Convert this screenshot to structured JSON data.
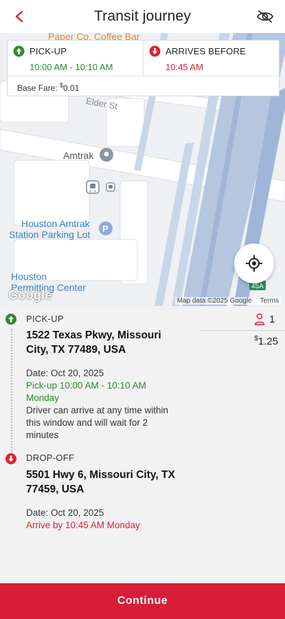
{
  "header": {
    "title": "Transit journey",
    "back_icon": "chevron-left-icon",
    "visibility_icon": "eye-off-icon"
  },
  "map": {
    "labels": {
      "coffee": "Paper Co. Coffee Bar",
      "street": "Elder St",
      "amtrak": "Amtrak",
      "parking_line1": "Houston Amtrak",
      "parking_line2": "Station Parking Lot",
      "permitting_line1": "Houston",
      "permitting_line2": "Permitting Center",
      "highway_shield": "45A"
    },
    "google": "Google",
    "map_data": "Map data ©2025 Google",
    "terms": "Terms",
    "locate_icon": "crosshair-icon"
  },
  "info_card": {
    "pickup_label": "PICK-UP",
    "pickup_window": "10:00 AM - 10:10 AM",
    "arrives_label": "ARRIVES BEFORE",
    "arrives_time": "10:45 AM",
    "fare_label": "Base Fare: ",
    "fare_currency": "$",
    "fare_amount": "0.01"
  },
  "trip": {
    "pickup": {
      "label": "PICK-UP",
      "address_line1": "1522 Texas Pkwy, Missouri",
      "address_line2": "City, TX 77489, USA",
      "date": "Date: Oct 20, 2025",
      "window": "Pick-up 10:00 AM - 10:10 AM",
      "day": "Monday",
      "note_line1": "Driver can arrive at any time within",
      "note_line2": "this window and will wait for 2",
      "note_line3": "minutes"
    },
    "dropoff": {
      "label": "DROP-OFF",
      "address_line1": "5501 Hwy 6, Missouri City, TX",
      "address_line2": "77459, USA",
      "date": "Date: Oct 20, 2025",
      "arrive_by": "Arrive by 10:45 AM Monday"
    },
    "passengers": "1",
    "passenger_icon": "person-icon",
    "price_currency": "$",
    "price": "1.25"
  },
  "footer": {
    "continue_label": "Continue"
  },
  "colors": {
    "accent_red": "#d81e36",
    "pickup_green": "#2e8a2e",
    "dropoff_red": "#e0202f"
  }
}
